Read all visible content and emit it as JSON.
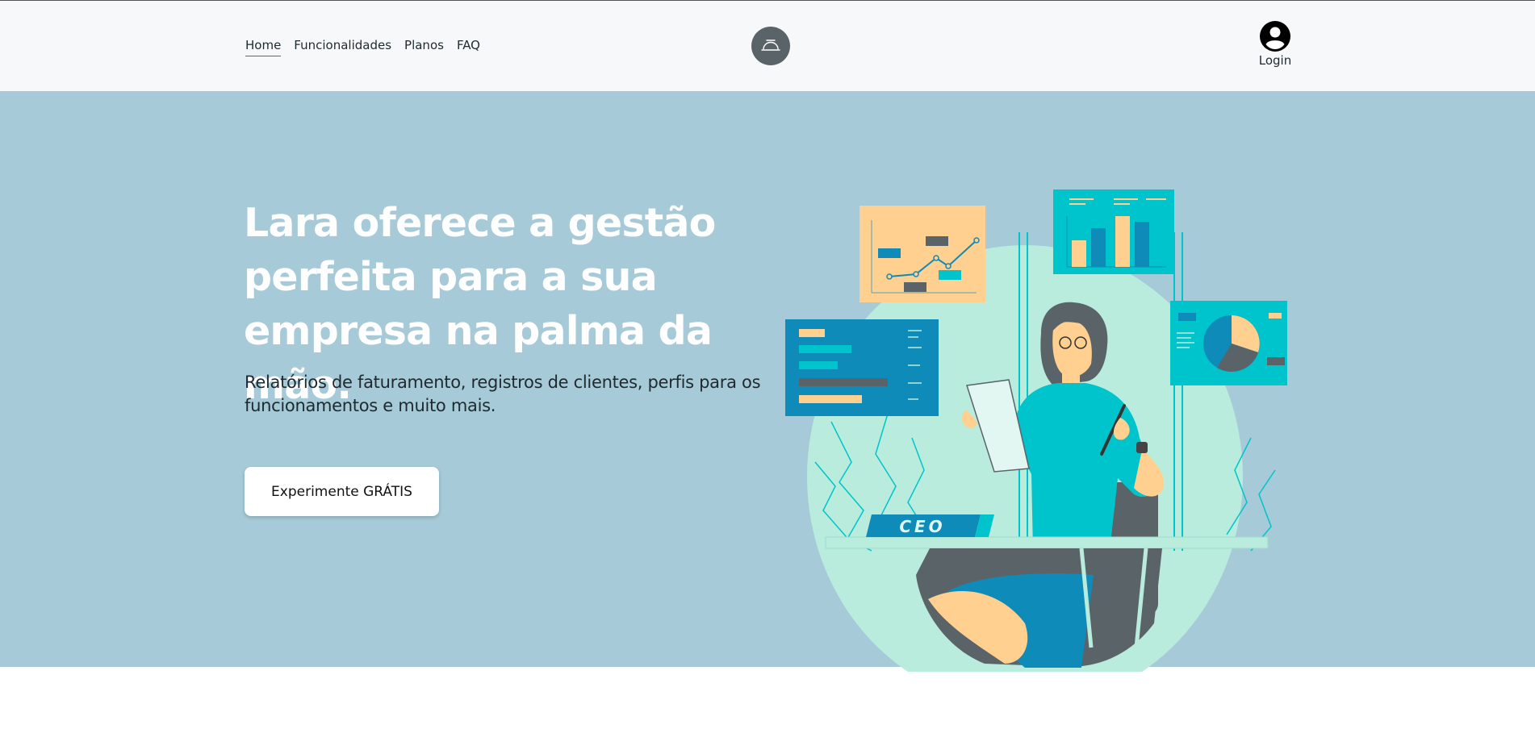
{
  "nav": {
    "items": [
      {
        "label": "Home",
        "active": true
      },
      {
        "label": "Funcionalidades",
        "active": false
      },
      {
        "label": "Planos",
        "active": false
      },
      {
        "label": "FAQ",
        "active": false
      }
    ]
  },
  "logo": {
    "icon": "service-bell-icon"
  },
  "account": {
    "icon": "user-circle-icon",
    "label": "Login"
  },
  "hero": {
    "headline_line1": "Lara oferece a gestão",
    "headline_line2": "perfeita para a sua",
    "headline_line3": "empresa na palma da mão.",
    "subhead_line1": "Relatórios de faturamento, registros de clientes, perfis para os",
    "subhead_line2": "funcionamentos e muito mais.",
    "cta_label": "Experimente GRÁTIS"
  },
  "illustration": {
    "desk_sign": "CEO"
  },
  "colors": {
    "header_bg": "#f7f8f9",
    "hero_bg": "#a6cad7",
    "accent_teal": "#00c4cc",
    "accent_blue": "#0e8bb8",
    "accent_peach": "#ffd08f",
    "mint": "#b9ecdc",
    "charcoal": "#5a6468"
  }
}
